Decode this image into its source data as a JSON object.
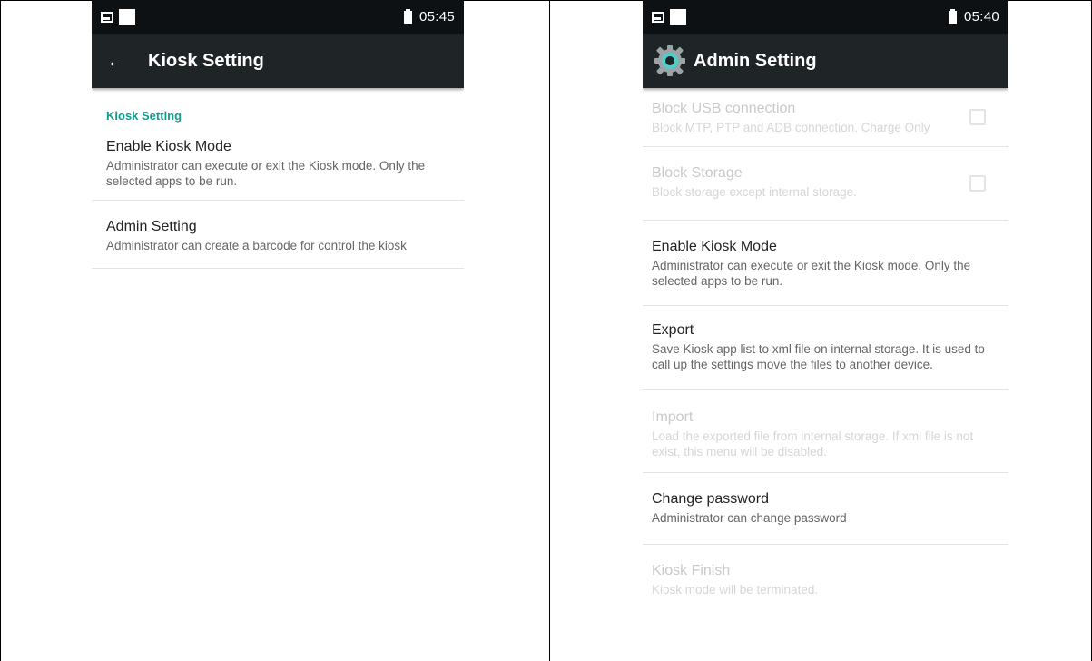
{
  "left_screen": {
    "status": {
      "time": "05:45"
    },
    "toolbar": {
      "title": "Kiosk Setting"
    },
    "section_header": "Kiosk Setting",
    "items": [
      {
        "title": "Enable Kiosk Mode",
        "summary": "Administrator can execute or exit the Kiosk mode. Only the selected apps to be run."
      },
      {
        "title": "Admin Setting",
        "summary": "Administrator can create a barcode for control the kiosk"
      }
    ]
  },
  "right_screen": {
    "status": {
      "time": "05:40"
    },
    "toolbar": {
      "title": "Admin Setting"
    },
    "items": [
      {
        "title": "Block USB connection",
        "summary": "Block MTP, PTP and ADB connection. Charge Only",
        "enabled": false,
        "checkbox": true
      },
      {
        "title": "Block Storage",
        "summary": "Block storage except internal storage.",
        "enabled": false,
        "checkbox": true
      },
      {
        "title": "Enable Kiosk Mode",
        "summary": "Administrator can execute or exit the Kiosk mode. Only the selected apps to be run.",
        "enabled": true
      },
      {
        "title": "Export",
        "summary": "Save Kiosk app list to xml file on internal storage. It is used to call up the settings move the files to another device.",
        "enabled": true
      },
      {
        "title": "Import",
        "summary": "Load the exported file from internal storage. If xml file is not exist, this menu will be disabled.",
        "enabled": false
      },
      {
        "title": "Change password",
        "summary": "Administrator can change password",
        "enabled": true
      },
      {
        "title": "Kiosk Finish",
        "summary": "Kiosk mode will be terminated.",
        "enabled": false
      }
    ]
  },
  "colors": {
    "status_bar": "#0d1113",
    "toolbar": "#1f2427",
    "accent": "#0f9d8e",
    "app_icon_teal": "#4dd0c8"
  },
  "icons": [
    "image-icon",
    "notification-square-icon",
    "battery-icon",
    "back-arrow-icon",
    "gear-app-icon"
  ]
}
